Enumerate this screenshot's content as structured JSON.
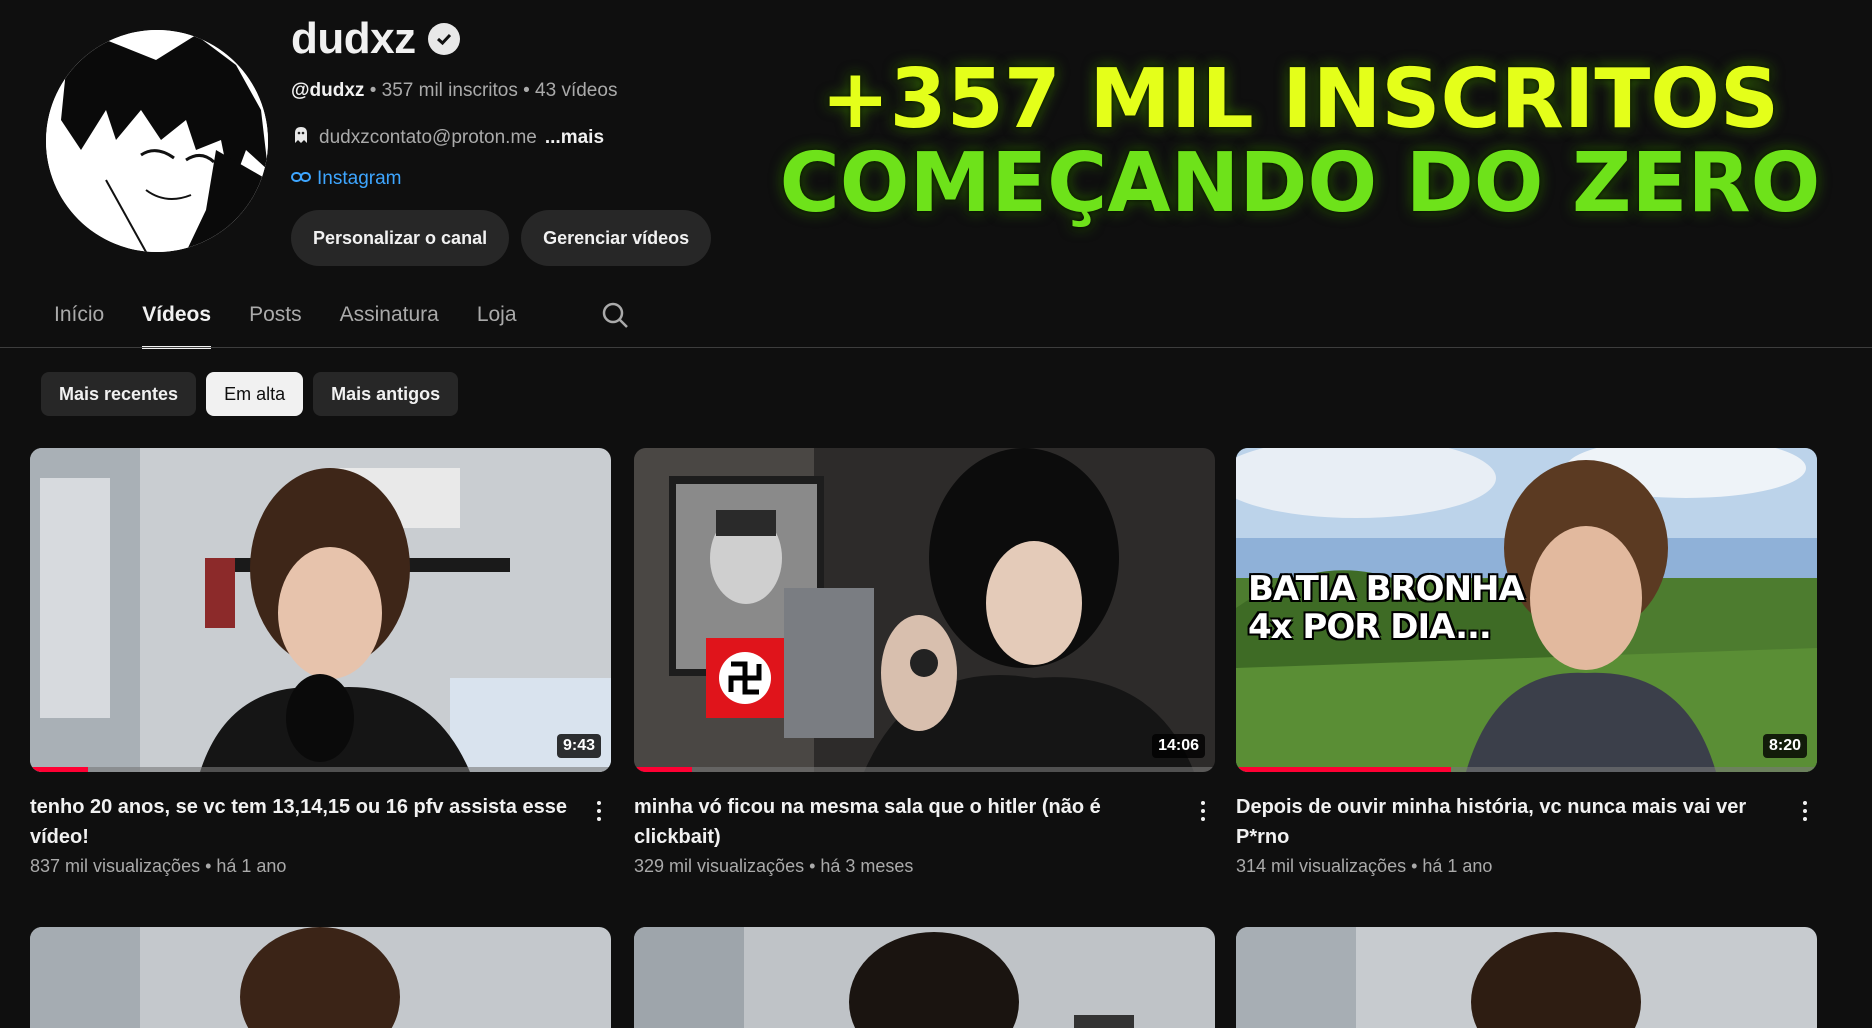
{
  "channel": {
    "name": "dudxz",
    "handle": "@dudxz",
    "stats": " • 357 mil inscritos • 43 vídeos",
    "contact": "dudxzcontato@proton.me",
    "more": "...mais",
    "link": "Instagram",
    "buttons": {
      "customize": "Personalizar o canal",
      "manage": "Gerenciar vídeos"
    }
  },
  "banner": {
    "line1": "+357 MIL INSCRITOS",
    "line2": "COMEÇANDO DO ZERO"
  },
  "tabs": [
    "Início",
    "Vídeos",
    "Posts",
    "Assinatura",
    "Loja"
  ],
  "chips": [
    "Mais recentes",
    "Em alta",
    "Mais antigos"
  ],
  "videos": [
    {
      "title": "tenho 20 anos, se vc tem 13,14,15 ou 16 pfv assista esse vídeo!",
      "stats": "837 mil visualizações • há 1 ano",
      "duration": "9:43",
      "watched": 0.1
    },
    {
      "title": "minha vó ficou na mesma sala que o hitler (não é clickbait)",
      "stats": "329 mil visualizações • há 3 meses",
      "duration": "14:06",
      "watched": 0.1
    },
    {
      "title": "Depois de ouvir minha história, vc nunca mais vai ver P*rno",
      "stats": "314 mil visualizações • há 1 ano",
      "duration": "8:20",
      "watched": 0.37,
      "overlay": "BATIA BRONHA\n4x POR DIA..."
    }
  ],
  "colors": {
    "accent_red": "#ff0033",
    "banner_yellow": "#e4ff1a",
    "banner_green": "#6ee21a",
    "link_blue": "#3ea6ff"
  }
}
